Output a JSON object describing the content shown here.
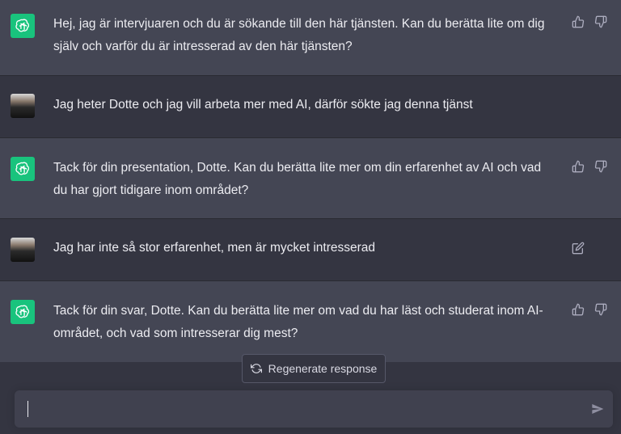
{
  "messages": [
    {
      "role": "assistant",
      "text": "Hej, jag är intervjuaren och du är sökande till den här tjänsten. Kan du berätta lite om dig själv och varför du är intresserad av den här tjänsten?"
    },
    {
      "role": "user",
      "text": "Jag heter Dotte och jag vill arbeta mer med AI, därför sökte jag denna tjänst"
    },
    {
      "role": "assistant",
      "text": "Tack för din presentation, Dotte. Kan du berätta lite mer om din erfarenhet av AI och vad du har gjort tidigare inom området?"
    },
    {
      "role": "user",
      "text": "Jag har inte så stor erfarenhet, men är mycket intresserad"
    },
    {
      "role": "assistant",
      "text": "Tack för din svar, Dotte. Kan du berätta lite mer om vad du har läst och studerat inom AI-området, och vad som intresserar dig mest?"
    }
  ],
  "regenerate_label": "Regenerate response",
  "composer": {
    "value": "",
    "placeholder": ""
  },
  "colors": {
    "assistant_bg": "#444654",
    "user_bg": "#343541",
    "gpt_avatar": "#19c37d",
    "text": "#ececf1"
  }
}
